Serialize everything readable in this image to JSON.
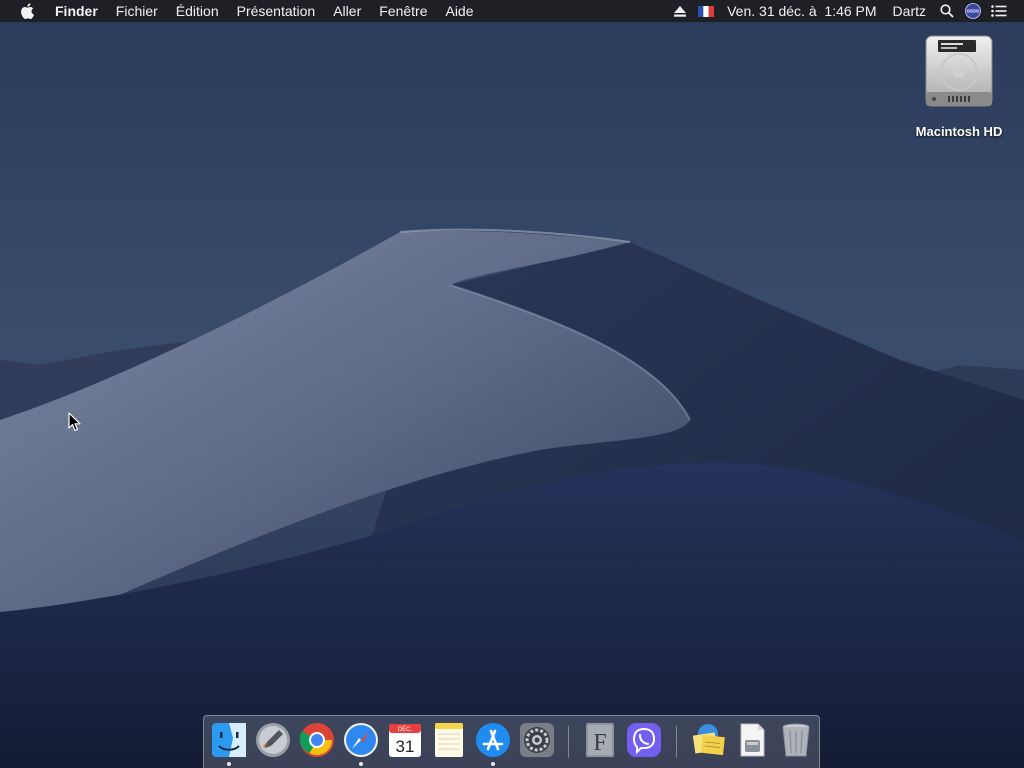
{
  "menubar": {
    "apple_icon": "apple-logo-icon",
    "app_name": "Finder",
    "menus": [
      "Fichier",
      "Édition",
      "Présentation",
      "Aller",
      "Fenêtre",
      "Aide"
    ],
    "status": {
      "eject_icon": "eject-icon",
      "input_source_icon": "french-flag-icon",
      "datetime": "Ven. 31 déc. à  1:46 PM",
      "user": "Dartz",
      "search_icon": "spotlight-search-icon",
      "siri_icon": "siri-icon",
      "notification_icon": "notification-center-icon"
    },
    "bg_color": "#1e1e22",
    "text_color": "#f2f2f2"
  },
  "desktop": {
    "icons": [
      {
        "label": "Macintosh HD",
        "icon": "hard-drive-icon"
      }
    ]
  },
  "dock": {
    "items": [
      {
        "name": "finder",
        "icon": "finder-icon",
        "running": true
      },
      {
        "name": "launchpad",
        "icon": "launchpad-icon",
        "running": false
      },
      {
        "name": "chrome",
        "icon": "chrome-icon",
        "running": false
      },
      {
        "name": "safari",
        "icon": "safari-icon",
        "running": true
      },
      {
        "name": "calendar",
        "icon": "calendar-icon",
        "running": false,
        "month": "DÉC.",
        "day": "31"
      },
      {
        "name": "notes",
        "icon": "notes-icon",
        "running": false
      },
      {
        "name": "app-store",
        "icon": "app-store-icon",
        "running": true
      },
      {
        "name": "system-preferences",
        "icon": "system-preferences-icon",
        "running": false
      },
      {
        "name": "font-book",
        "icon": "font-book-icon",
        "running": false,
        "glyph": "F"
      },
      {
        "name": "viber",
        "icon": "viber-icon",
        "running": false
      },
      {
        "name": "stickies-folder",
        "icon": "stickies-folder-icon",
        "running": false
      },
      {
        "name": "downloads-stack",
        "icon": "document-stack-icon",
        "running": false
      },
      {
        "name": "trash",
        "icon": "trash-icon",
        "running": false
      }
    ]
  }
}
